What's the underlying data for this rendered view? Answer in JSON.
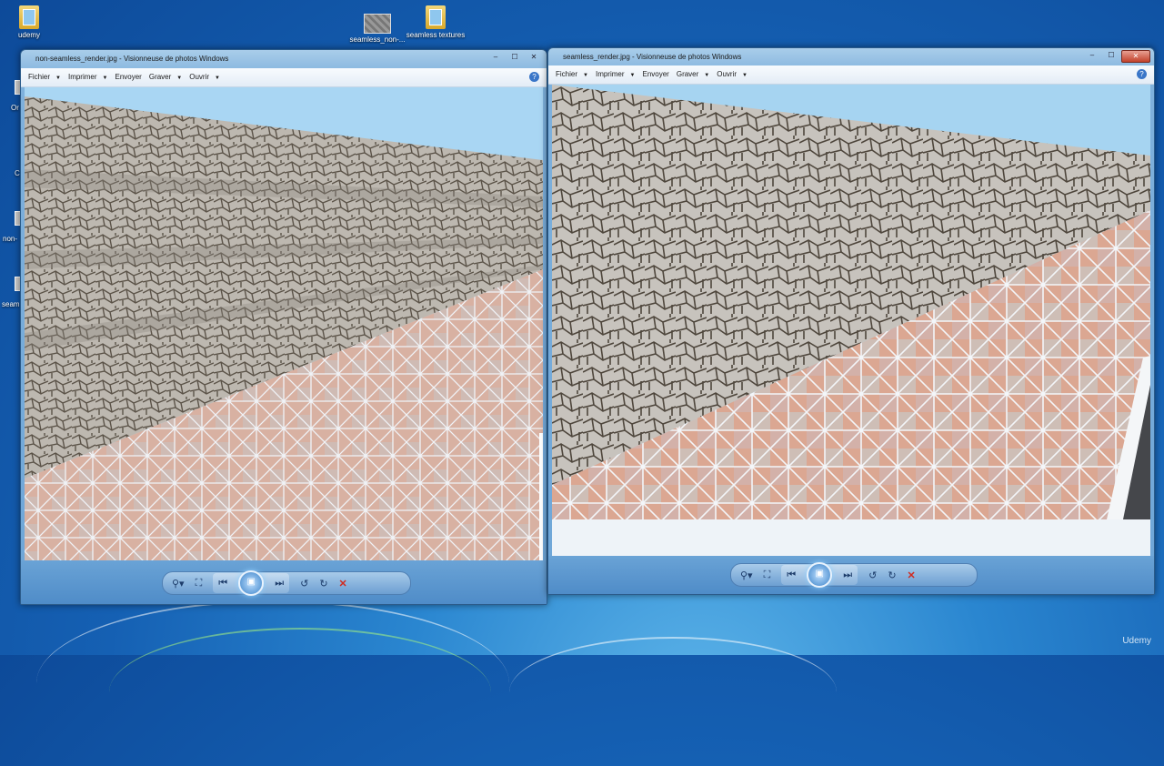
{
  "desktop": {
    "icons": [
      {
        "label": "udemy",
        "icon": "folder-icon"
      },
      {
        "label": "seamless_non-...",
        "icon": "image-thumbnail-icon"
      },
      {
        "label": "seamless textures",
        "icon": "folder-icon"
      }
    ],
    "edge_labels": [
      "Or",
      "C",
      "non-",
      "seam"
    ],
    "watermark": "Udemy"
  },
  "windows": [
    {
      "title": "non-seamless_render.jpg - Visionneuse de photos Windows",
      "menu": [
        "Fichier",
        "Imprimer",
        "Envoyer",
        "Graver",
        "Ouvrir"
      ],
      "controls": {
        "minimize": "–",
        "maximize": "☐",
        "close": "✕"
      },
      "help": "?"
    },
    {
      "title": "seamless_render.jpg - Visionneuse de photos Windows",
      "menu": [
        "Fichier",
        "Imprimer",
        "Envoyer",
        "Graver",
        "Ouvrir"
      ],
      "controls": {
        "minimize": "–",
        "maximize": "☐",
        "close": "✕"
      },
      "help": "?"
    }
  ],
  "toolbar_icons": {
    "zoom": "⚲▾",
    "fit": "⛶",
    "previous": "⏮",
    "slideshow": "▣",
    "next": "⏭",
    "rotate_left": "↺",
    "rotate_right": "↻",
    "delete": "✕"
  },
  "colors": {
    "desktop": "#1560b3",
    "sky": "#9fd2f2",
    "stone": "#b9b4ac",
    "floor": "#d6a18e"
  }
}
